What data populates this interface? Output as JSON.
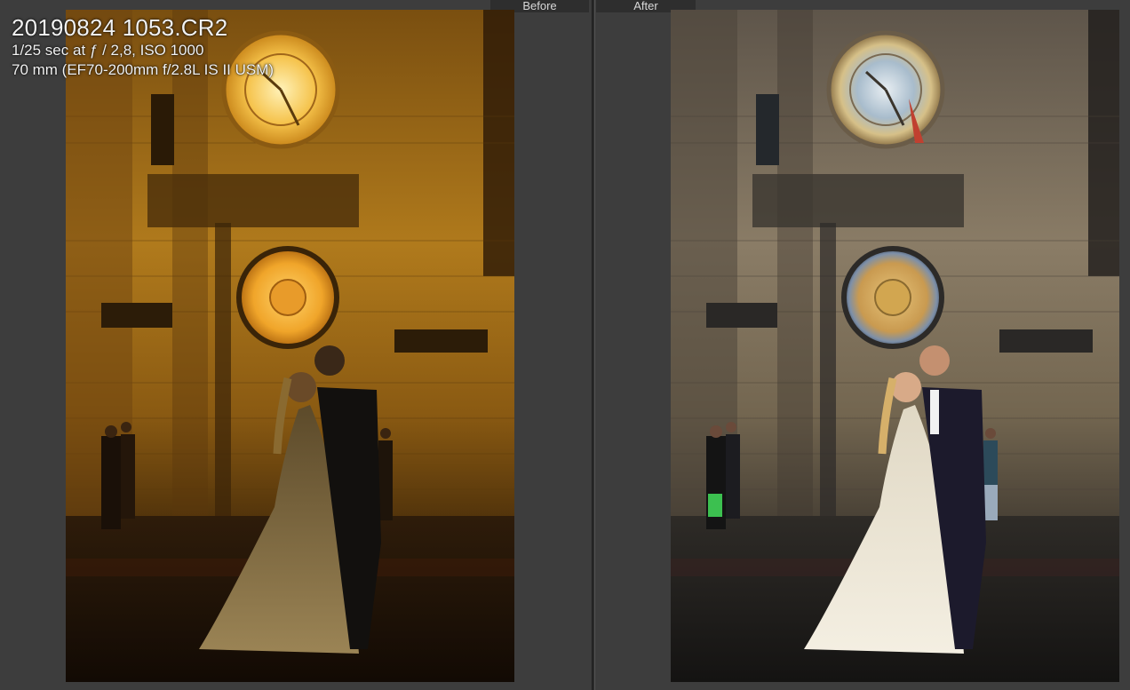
{
  "compare_view": {
    "before_label": "Before",
    "after_label": "After"
  },
  "info_overlay": {
    "filename": "20190824 1053.CR2",
    "exposure": "1/25 sec at ƒ / 2,8, ISO 1000",
    "lens": "70 mm (EF70-200mm f/2.8L IS II USM)"
  },
  "colors": {
    "background": "#3c3c3c",
    "label_bg": "#2e2e2e",
    "before_tone": "#c98a1a",
    "after_tone": "#a89a80"
  }
}
